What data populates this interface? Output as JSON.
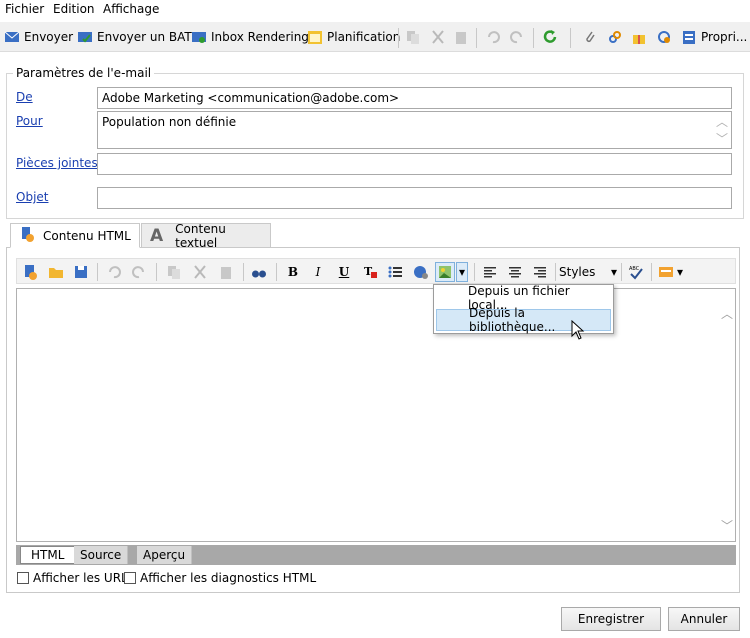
{
  "menu": {
    "fichier": "Fichier",
    "edition": "Edition",
    "affichage": "Affichage"
  },
  "toolbar": {
    "envoyer": "Envoyer",
    "envoyer_bat": "Envoyer un BAT",
    "inbox_rendering": "Inbox Rendering",
    "planification": "Planification",
    "proprietes": "Propri..."
  },
  "params": {
    "legend": "Paramètres de l'e-mail",
    "de_label": "De",
    "de_value": "Adobe Marketing <communication@adobe.com>",
    "pour_label": "Pour",
    "pour_value": "Population non définie",
    "pj_label": "Pièces jointes",
    "pj_value": "",
    "objet_label": "Objet",
    "objet_value": ""
  },
  "tabs": {
    "html": "Contenu HTML",
    "text": "Contenu textuel"
  },
  "editor_toolbar": {
    "bold": "B",
    "italic": "I",
    "underline": "U",
    "styles": "Styles"
  },
  "dropdown": {
    "item1": "Depuis un fichier local...",
    "item2": "Depuis la bibliothèque..."
  },
  "mini_tabs": {
    "html": "HTML",
    "source": "Source",
    "apercu": "Aperçu"
  },
  "checkboxes": {
    "show_urls": "Afficher les URL",
    "show_diag": "Afficher les diagnostics HTML"
  },
  "buttons": {
    "save": "Enregistrer",
    "cancel": "Annuler"
  },
  "colors": {
    "link_blue": "#1a3fb0",
    "accent_green": "#2e9b2e",
    "highlight": "#d5e8f7"
  }
}
